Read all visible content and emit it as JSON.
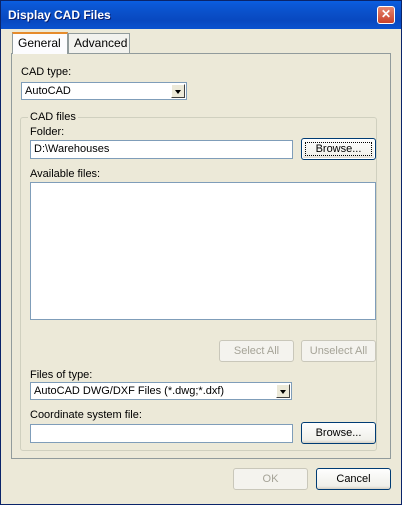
{
  "window": {
    "title": "Display CAD Files"
  },
  "tabs": [
    {
      "label": "General"
    },
    {
      "label": "Advanced"
    }
  ],
  "general": {
    "cad_type_label": "CAD type:",
    "cad_type_value": "AutoCAD",
    "cad_files_group": "CAD files",
    "folder_label": "Folder:",
    "folder_value": "D:\\Warehouses",
    "browse_label": "Browse...",
    "available_files_label": "Available files:",
    "available_files": [],
    "select_all_label": "Select All",
    "unselect_all_label": "Unselect All",
    "files_of_type_label": "Files of type:",
    "files_of_type_value": "AutoCAD DWG/DXF Files (*.dwg;*.dxf)",
    "coord_file_label": "Coordinate system file:",
    "coord_file_value": "",
    "browse2_label": "Browse..."
  },
  "footer": {
    "ok_label": "OK",
    "cancel_label": "Cancel"
  }
}
